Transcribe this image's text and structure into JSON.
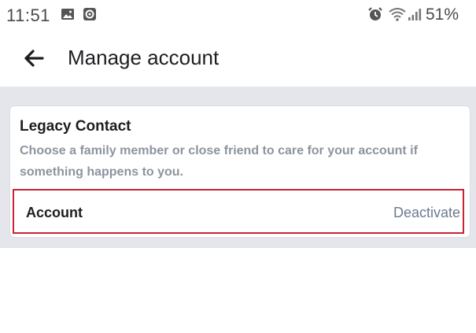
{
  "status_bar": {
    "time": "11:51",
    "battery": "51%",
    "icons": [
      "image-icon",
      "app-icon",
      "alarm-icon",
      "wifi-icon",
      "signal-icon"
    ]
  },
  "header": {
    "title": "Manage account",
    "back_icon": "arrow-left-icon"
  },
  "legacy_contact": {
    "title": "Legacy Contact",
    "description": "Choose a family member or close friend to care for your account if something happens to you."
  },
  "account_row": {
    "label": "Account",
    "action": "Deactivate",
    "highlight_color": "#c82333"
  },
  "colors": {
    "background": "#e4e6eb",
    "secondary_text": "#8d949e",
    "link_text": "#6b7a8f"
  }
}
